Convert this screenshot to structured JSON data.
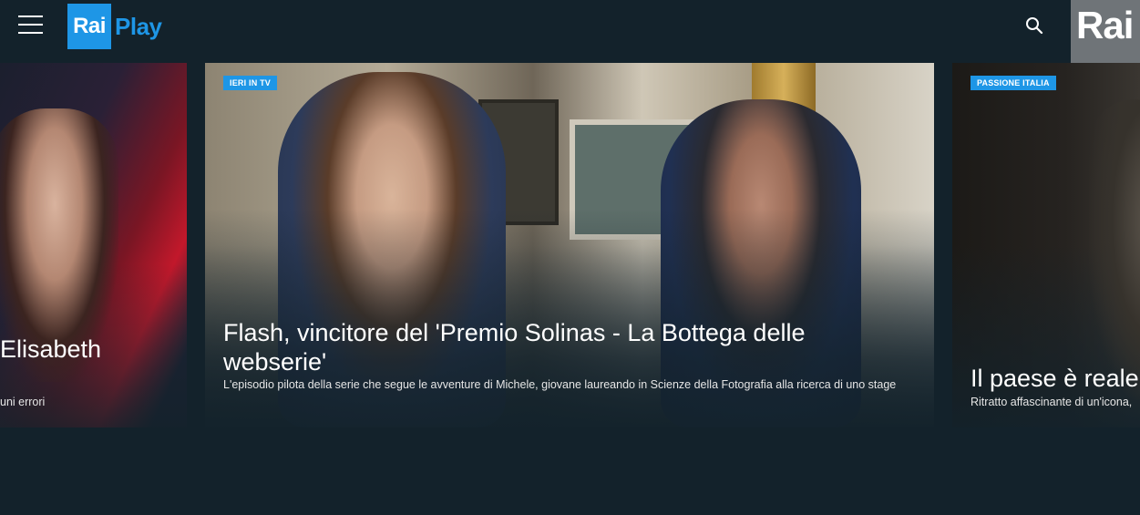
{
  "header": {
    "logo_rai": "Rai",
    "logo_play": "Play",
    "corner_logo": "Rai",
    "menu_icon": "hamburger-menu-icon",
    "search_icon": "search-icon"
  },
  "carousel": {
    "left": {
      "title": "Elisabeth",
      "desc": "uni errori"
    },
    "main": {
      "badge": "IERI IN TV",
      "title": "Flash, vincitore del 'Premio Solinas - La Bottega delle webserie'",
      "desc": "L'episodio pilota della serie che segue le avventure di Michele, giovane laureando in Scienze della Fotografia alla ricerca di uno stage"
    },
    "right": {
      "badge": "PASSIONE ITALIA",
      "title": "Il paese è reale",
      "desc": "Ritratto affascinante di un'icona,"
    }
  },
  "colors": {
    "background": "#13222b",
    "accent": "#1e96e6",
    "corner": "#6f7478"
  }
}
